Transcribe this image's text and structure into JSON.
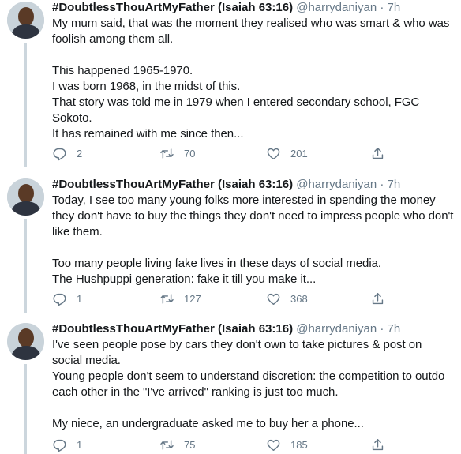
{
  "tweets": [
    {
      "name": "#DoubtlessThouArtMyFather (Isaiah 63:16)",
      "handle": "@harrydaniyan",
      "separator": "·",
      "time": "7h",
      "text": "My mum said, that was the moment they realised who was smart & who was foolish among them all.\n\nThis happened 1965-1970.\nI was born 1968, in the midst of this.\nThat story was told me in 1979 when I entered secondary school, FGC Sokoto.\nIt has remained with me since then...",
      "replies": "2",
      "retweets": "70",
      "likes": "201"
    },
    {
      "name": "#DoubtlessThouArtMyFather (Isaiah 63:16)",
      "handle": "@harrydaniyan",
      "separator": "·",
      "time": "7h",
      "text": "Today, I see too many young folks more interested in spending the money they don't have to buy the things they don't need to impress people who don't like them.\n\nToo many people living fake lives in these days of social media.\nThe Hushpuppi generation: fake it till you make it...",
      "replies": "1",
      "retweets": "127",
      "likes": "368"
    },
    {
      "name": "#DoubtlessThouArtMyFather (Isaiah 63:16)",
      "handle": "@harrydaniyan",
      "separator": "·",
      "time": "7h",
      "text": "I've seen people pose by cars they don't own to take pictures & post on social media.\nYoung people don't seem to understand discretion: the competition to outdo each other in the \"I've arrived\" ranking is just too much.\n\nMy niece, an undergraduate asked me to buy her a phone...",
      "replies": "1",
      "retweets": "75",
      "likes": "185"
    }
  ],
  "icons": {
    "reply": "reply-icon",
    "retweet": "retweet-icon",
    "like": "like-icon",
    "share": "share-icon"
  },
  "colors": {
    "text": "#14171a",
    "muted": "#657786",
    "divider": "#e6ecf0",
    "thread_line": "#ccd6dd"
  }
}
